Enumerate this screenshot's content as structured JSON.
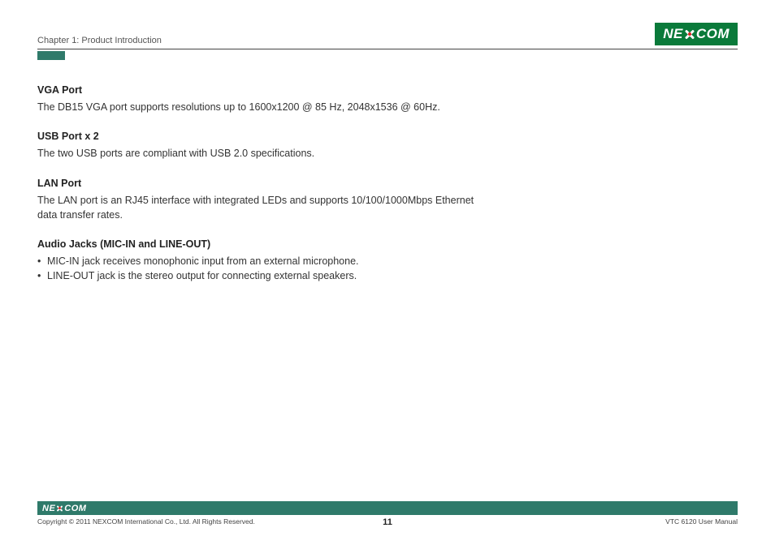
{
  "header": {
    "chapter": "Chapter 1: Product Introduction",
    "brand_left": "NE",
    "brand_right": "COM"
  },
  "sections": [
    {
      "title": "VGA Port",
      "body": "The DB15 VGA port supports resolutions up to 1600x1200 @ 85 Hz, 2048x1536 @ 60Hz."
    },
    {
      "title": "USB Port x 2",
      "body": "The two USB ports are compliant with USB 2.0 specifications."
    },
    {
      "title": "LAN Port",
      "body": "The LAN port is an RJ45 interface with integrated LEDs and supports 10/100/1000Mbps Ethernet data transfer rates."
    }
  ],
  "audio": {
    "title": "Audio Jacks (MIC-IN and LINE-OUT)",
    "bullets": [
      "MIC-IN jack receives monophonic input from an external microphone.",
      "LINE-OUT jack is the stereo output for connecting external speakers."
    ]
  },
  "footer": {
    "copyright": "Copyright © 2011 NEXCOM International Co., Ltd. All Rights Reserved.",
    "page": "11",
    "doc": "VTC 6120 User Manual"
  }
}
